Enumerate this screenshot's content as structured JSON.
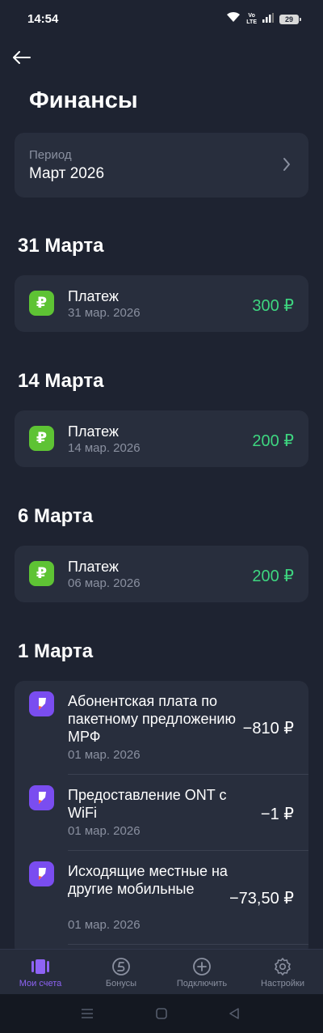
{
  "status_bar": {
    "time": "14:54",
    "volte_top": "Vo",
    "volte_bottom": "LTE",
    "battery": "29"
  },
  "page": {
    "title": "Финансы"
  },
  "period": {
    "label": "Период",
    "value": "Март 2026"
  },
  "groups": [
    {
      "date": "31 Марта",
      "items": [
        {
          "icon": "ruble-icon",
          "title": "Платеж",
          "date": "31 мар. 2026",
          "amount": "300 ₽"
        }
      ]
    },
    {
      "date": "14 Марта",
      "items": [
        {
          "icon": "ruble-icon",
          "title": "Платеж",
          "date": "14 мар. 2026",
          "amount": "200 ₽"
        }
      ]
    },
    {
      "date": "6 Марта",
      "items": [
        {
          "icon": "ruble-icon",
          "title": "Платеж",
          "date": "06 мар. 2026",
          "amount": "200 ₽"
        }
      ]
    },
    {
      "date": "1 Марта",
      "items": [
        {
          "icon": "rostelecom-icon",
          "title": "Абонентская плата по пакетному предложению МРФ",
          "date": "01 мар. 2026",
          "amount": "−810 ₽"
        },
        {
          "icon": "rostelecom-icon",
          "title": "Предоставление ONT с WiFi",
          "date": "01 мар. 2026",
          "amount": "−1 ₽"
        },
        {
          "icon": "rostelecom-icon",
          "title": "Исходящие местные на другие мобильные",
          "date": "01 мар. 2026",
          "amount": "−73,50 ₽"
        }
      ]
    }
  ],
  "bottom_nav": [
    {
      "label": "Мои счета",
      "icon": "accounts-icon",
      "active": true
    },
    {
      "label": "Бонусы",
      "icon": "bonus-icon",
      "active": false
    },
    {
      "label": "Подключить",
      "icon": "plus-circle-icon",
      "active": false
    },
    {
      "label": "Настройки",
      "icon": "gear-icon",
      "active": false
    }
  ],
  "colors": {
    "background": "#1e2331",
    "card": "#282e3d",
    "positive": "#3ed680",
    "accent": "#8e63f5",
    "ruble_badge": "#5ec334"
  }
}
